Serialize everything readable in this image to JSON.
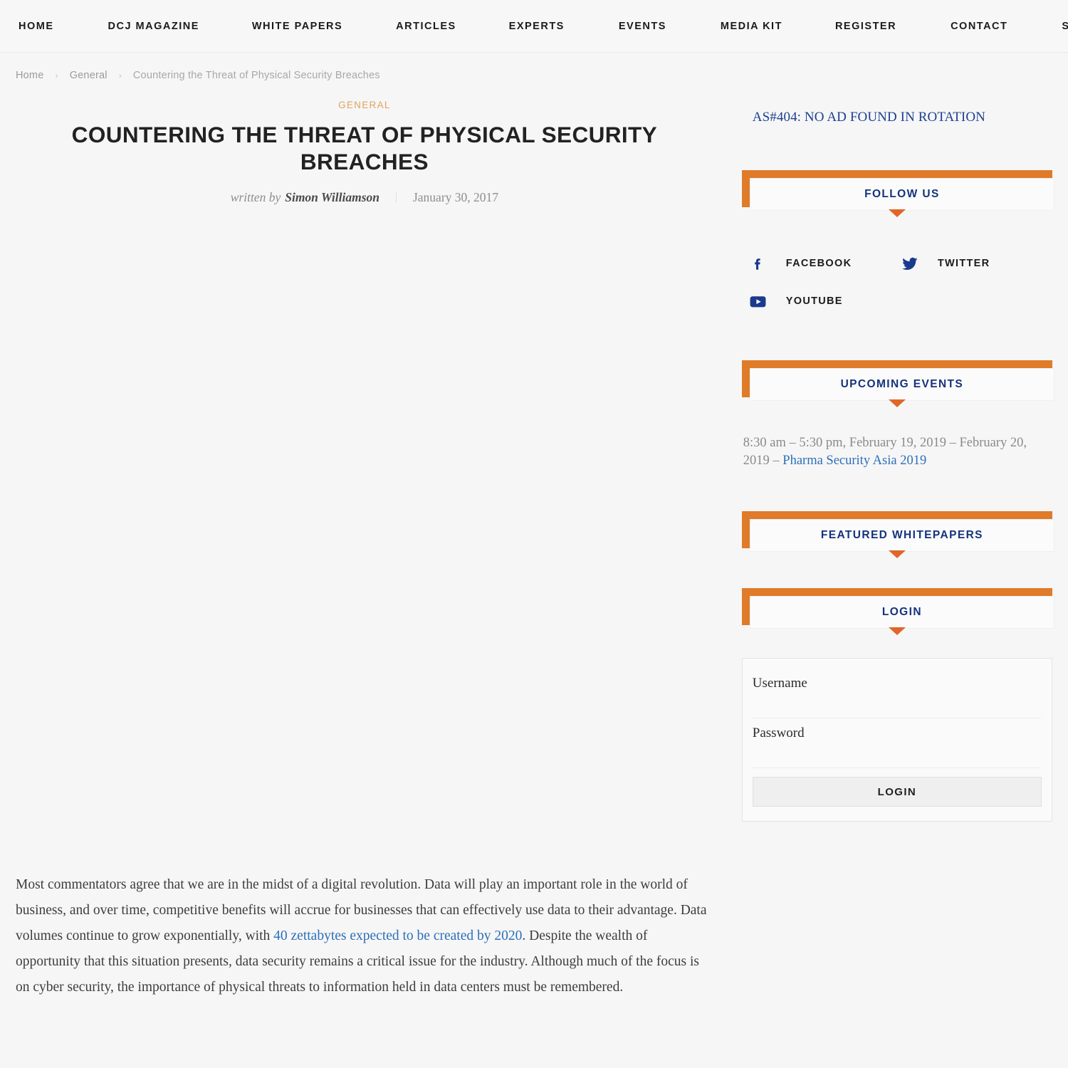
{
  "nav": {
    "items": [
      {
        "label": "HOME",
        "name": "nav-item-home"
      },
      {
        "label": "DCJ MAGAZINE",
        "name": "nav-item-dcj-magazine"
      },
      {
        "label": "WHITE PAPERS",
        "name": "nav-item-white-papers"
      },
      {
        "label": "ARTICLES",
        "name": "nav-item-articles"
      },
      {
        "label": "EXPERTS",
        "name": "nav-item-experts"
      },
      {
        "label": "EVENTS",
        "name": "nav-item-events"
      },
      {
        "label": "MEDIA KIT",
        "name": "nav-item-media-kit"
      },
      {
        "label": "REGISTER",
        "name": "nav-item-register"
      },
      {
        "label": "CONTACT",
        "name": "nav-item-contact"
      },
      {
        "label": "SUBSCRIBE",
        "name": "nav-item-subscribe"
      }
    ],
    "search_icon": "search-icon"
  },
  "breadcrumb": {
    "home": "Home",
    "category": "General",
    "current": "Countering the Threat of Physical Security Breaches",
    "separator": "›"
  },
  "article": {
    "category": "GENERAL",
    "title": "COUNTERING THE THREAT OF PHYSICAL SECURITY BREACHES",
    "written_by": "written by",
    "author": "Simon Williamson",
    "date": "January 30, 2017",
    "body_part1": "Most commentators agree that we are in the midst of a digital revolution. Data will play an important role in the world of business, and over time, competitive benefits will accrue for businesses that can effectively use data to their advantage. Data volumes continue to grow exponentially, with ",
    "body_link": "40 zettabytes expected to be created by 2020",
    "body_part2": ". Despite the wealth of opportunity that this situation presents, data security remains a critical issue for the industry. Although much of the focus is on cyber security, the importance of physical threats to information held in data centers must be remembered."
  },
  "sidebar": {
    "ad_notice": "AS#404: NO AD FOUND IN ROTATION",
    "follow_us": {
      "title": "FOLLOW US",
      "socials": [
        {
          "label": "FACEBOOK",
          "icon": "facebook-icon",
          "name": "social-link-facebook"
        },
        {
          "label": "TWITTER",
          "icon": "twitter-icon",
          "name": "social-link-twitter"
        },
        {
          "label": "YOUTUBE",
          "icon": "youtube-icon",
          "name": "social-link-youtube"
        }
      ]
    },
    "upcoming_events": {
      "title": "UPCOMING EVENTS",
      "event_time": "8:30 am – 5:30 pm, February 19, 2019 – February 20, 2019 – ",
      "event_link": "Pharma Security Asia 2019"
    },
    "featured_whitepapers": {
      "title": "FEATURED WHITEPAPERS"
    },
    "login": {
      "title": "LOGIN",
      "username_label": "Username",
      "username_value": "",
      "username_placeholder": "",
      "password_label": "Password",
      "password_value": "",
      "password_placeholder": "",
      "submit_label": "LOGIN"
    }
  },
  "colors": {
    "accent_orange": "#df7b29",
    "widget_title_blue": "#14327d",
    "link_blue": "#2c6fba",
    "category_orange": "#e0a45c",
    "page_bg": "#f6f6f6"
  }
}
